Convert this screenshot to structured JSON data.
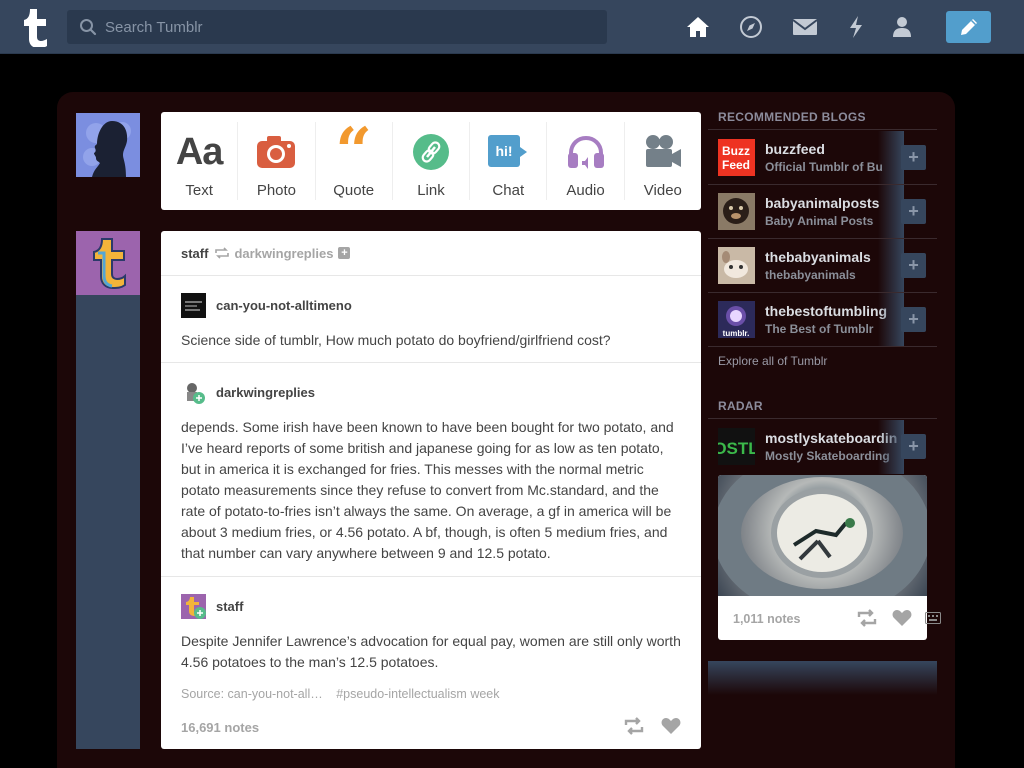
{
  "search": {
    "placeholder": "Search Tumblr"
  },
  "nav": [
    "home-icon",
    "explore-icon",
    "inbox-icon",
    "activity-icon",
    "account-icon",
    "compose-icon"
  ],
  "post_types": [
    {
      "label": "Text",
      "icon": "text-icon",
      "color": "#444444"
    },
    {
      "label": "Photo",
      "icon": "photo-icon",
      "color": "#d95e40"
    },
    {
      "label": "Quote",
      "icon": "quote-icon",
      "color": "#f2992e"
    },
    {
      "label": "Link",
      "icon": "link-icon",
      "color": "#56bc8a"
    },
    {
      "label": "Chat",
      "icon": "chat-icon",
      "color": "#529ecc"
    },
    {
      "label": "Audio",
      "icon": "audio-icon",
      "color": "#a77dc2"
    },
    {
      "label": "Video",
      "icon": "video-icon",
      "color": "#748089"
    }
  ],
  "post": {
    "author": "staff",
    "reblogged_from": "darkwingreplies",
    "segments": [
      {
        "user": "can-you-not-alltimeno",
        "text": "Science side of tumblr, How much potato do boyfriend/girlfriend cost?"
      },
      {
        "user": "darkwingreplies",
        "text": "depends. Some irish have been known to have been bought for two potato, and I’ve heard reports of some british and japanese going for as low as ten potato, but in america it is exchanged for fries. This messes with the normal metric potato measurements since they refuse to convert from Mc.standard, and the rate of potato-to-fries isn’t always the same. On average, a gf in america will be about 3 medium fries, or 4.56 potato. A bf, though, is often 5 medium fries, and that number can vary anywhere between 9 and 12.5 potato."
      },
      {
        "user": "staff",
        "text": "Despite Jennifer Lawrence’s advocation for equal pay, women are still only worth 4.56 potatoes to the man’s 12.5 potatoes."
      }
    ],
    "source": "Source: can-you-not-all…",
    "tag": "#pseudo-intellectualism week",
    "notes": "16,691 notes"
  },
  "sidebar": {
    "recommended_title": "RECOMMENDED BLOGS",
    "blogs": [
      {
        "name": "buzzfeed",
        "title": "Official Tumblr of Bu"
      },
      {
        "name": "babyanimalposts",
        "title": "Baby Animal Posts"
      },
      {
        "name": "thebabyanimals",
        "title": "thebabyanimals"
      },
      {
        "name": "thebestoftumbling",
        "title": "The Best of Tumblr"
      }
    ],
    "explore": "Explore all of Tumblr",
    "radar_title": "RADAR",
    "radar": {
      "name": "mostlyskateboardin",
      "title": "Mostly Skateboarding",
      "notes": "1,011 notes"
    }
  }
}
